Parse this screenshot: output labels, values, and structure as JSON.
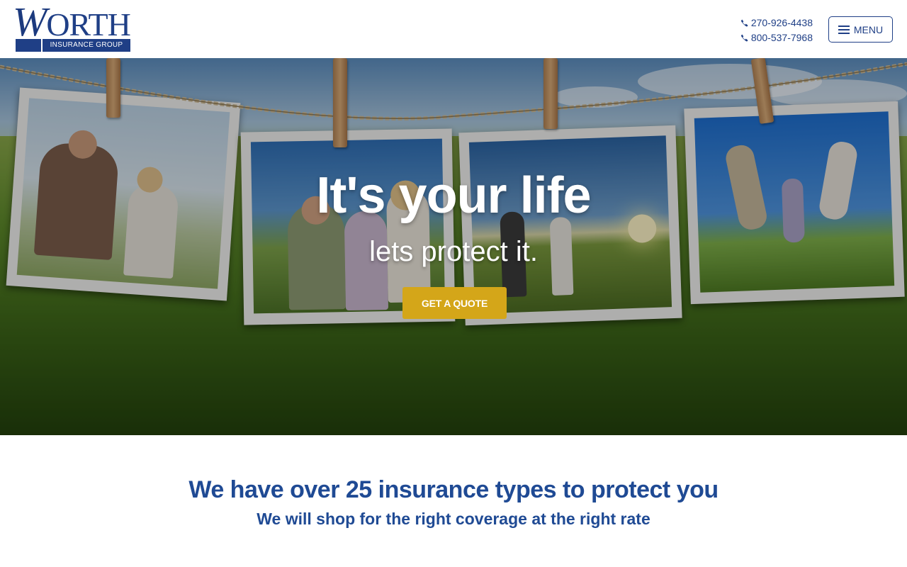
{
  "brand": {
    "logo_word": "ORTH",
    "logo_initial": "W",
    "logo_subtitle": "INSURANCE GROUP",
    "color_primary": "#1f3f86",
    "color_accent": "#d4a619"
  },
  "header": {
    "phones": [
      "270-926-4438",
      "800-537-7968"
    ],
    "phone_icon": "phone-icon",
    "menu_label": "MENU",
    "menu_icon": "hamburger-icon"
  },
  "hero": {
    "title": "It's your life",
    "subtitle": "lets protect it.",
    "cta_label": "GET A QUOTE"
  },
  "tagline": {
    "heading": "We have over 25 insurance types to protect you",
    "subheading": "We will shop for the right coverage at the right rate"
  }
}
